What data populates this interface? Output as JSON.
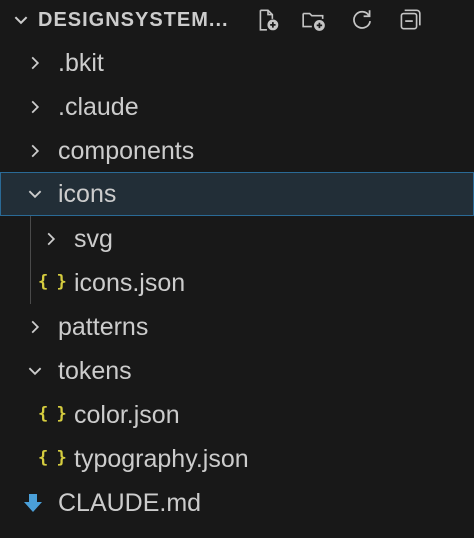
{
  "explorer": {
    "title": "DESIGNSYSTEM...",
    "actions": [
      {
        "name": "new-file",
        "icon": "new-file-icon"
      },
      {
        "name": "new-folder",
        "icon": "new-folder-icon"
      },
      {
        "name": "refresh",
        "icon": "refresh-icon"
      },
      {
        "name": "collapse-all",
        "icon": "collapse-all-icon"
      }
    ],
    "items": [
      {
        "label": ".bkit",
        "type": "folder",
        "expanded": false
      },
      {
        "label": ".claude",
        "type": "folder",
        "expanded": false
      },
      {
        "label": "components",
        "type": "folder",
        "expanded": false
      },
      {
        "label": "icons",
        "type": "folder",
        "expanded": true,
        "selected": true
      },
      {
        "label": "svg",
        "type": "folder",
        "expanded": false
      },
      {
        "label": "icons.json",
        "type": "json",
        "icon_text": "{ }"
      },
      {
        "label": "patterns",
        "type": "folder",
        "expanded": false
      },
      {
        "label": "tokens",
        "type": "folder",
        "expanded": true
      },
      {
        "label": "color.json",
        "type": "json",
        "icon_text": "{ }"
      },
      {
        "label": "typography.json",
        "type": "json",
        "icon_text": "{ }"
      },
      {
        "label": "CLAUDE.md",
        "type": "markdown"
      }
    ]
  },
  "colors": {
    "background": "#181818",
    "text": "#cccccc",
    "selection_bg": "#222e37",
    "selection_border": "#2a6a96",
    "json_icon": "#d6cd3f",
    "md_icon": "#4a9fd8"
  }
}
